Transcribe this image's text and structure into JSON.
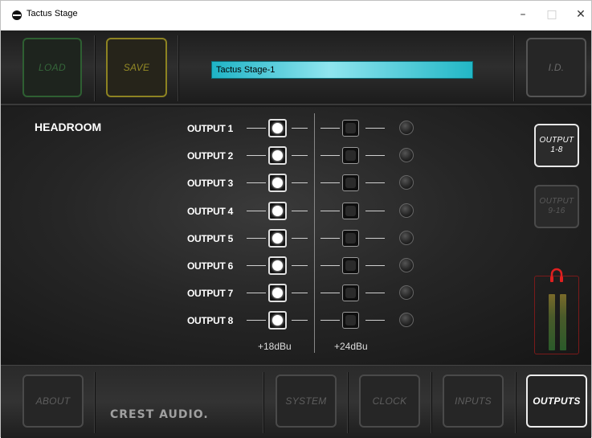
{
  "window": {
    "title": "Tactus Stage",
    "minimize": "–",
    "maximize": "□",
    "close": "✕"
  },
  "toolbar": {
    "load": "LOAD",
    "save": "SAVE",
    "device_name": "Tactus Stage-1",
    "id": "I.D."
  },
  "main": {
    "section_title": "HEADROOM",
    "outputs": [
      {
        "label": "OUTPUT 1"
      },
      {
        "label": "OUTPUT 2"
      },
      {
        "label": "OUTPUT 3"
      },
      {
        "label": "OUTPUT 4"
      },
      {
        "label": "OUTPUT 5"
      },
      {
        "label": "OUTPUT 6"
      },
      {
        "label": "OUTPUT 7"
      },
      {
        "label": "OUTPUT 8"
      }
    ],
    "level_left": "+18dBu",
    "level_right": "+24dBu",
    "output_1_8": "OUTPUT\n1-8",
    "output_9_16": "OUTPUT\n9-16"
  },
  "nav": {
    "about": "ABOUT",
    "logo": "CREST AUDIO.",
    "system": "SYSTEM",
    "clock": "CLOCK",
    "inputs": "INPUTS",
    "outputs": "OUTPUTS"
  },
  "colors": {
    "accent_cyan": "#1fb3c5",
    "load_green": "#2e5f32",
    "save_yellow": "#8d8322",
    "meter_red": "#7a1a1a"
  }
}
